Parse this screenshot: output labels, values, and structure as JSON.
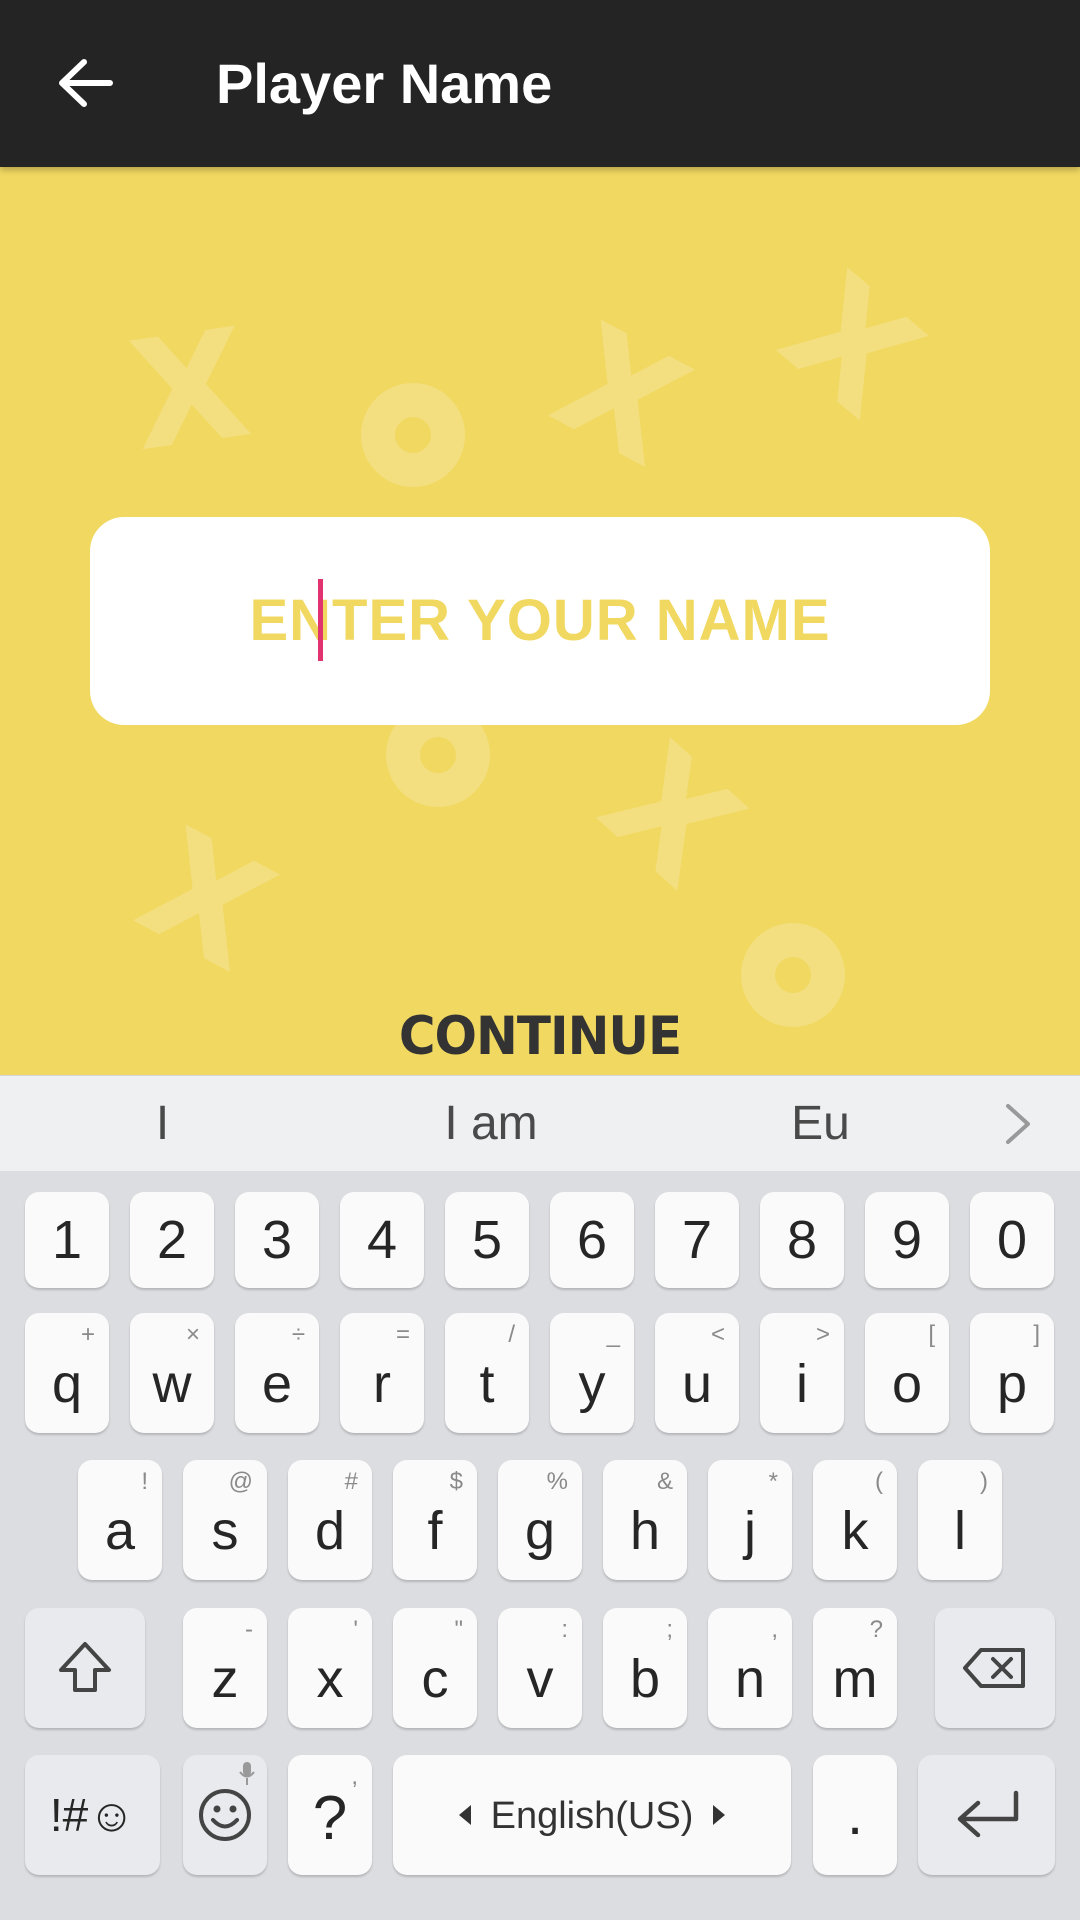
{
  "appbar": {
    "title": "Player Name"
  },
  "name_card": {
    "placeholder": "ENTER YOUR NAME"
  },
  "continue_label": "CONTINUE",
  "colors": {
    "background": "#f1d861",
    "appbar": "#242424",
    "caret": "#e0336f",
    "placeholder": "#f1d861"
  },
  "keyboard": {
    "suggestions": [
      "I",
      "I am",
      "Eu"
    ],
    "row_digits": [
      "1",
      "2",
      "3",
      "4",
      "5",
      "6",
      "7",
      "8",
      "9",
      "0"
    ],
    "row_q": [
      {
        "k": "q",
        "h": "+"
      },
      {
        "k": "w",
        "h": "×"
      },
      {
        "k": "e",
        "h": "÷"
      },
      {
        "k": "r",
        "h": "="
      },
      {
        "k": "t",
        "h": "/"
      },
      {
        "k": "y",
        "h": "_"
      },
      {
        "k": "u",
        "h": "<"
      },
      {
        "k": "i",
        "h": ">"
      },
      {
        "k": "o",
        "h": "["
      },
      {
        "k": "p",
        "h": "]"
      }
    ],
    "row_a": [
      {
        "k": "a",
        "h": "!"
      },
      {
        "k": "s",
        "h": "@"
      },
      {
        "k": "d",
        "h": "#"
      },
      {
        "k": "f",
        "h": "$"
      },
      {
        "k": "g",
        "h": "%"
      },
      {
        "k": "h",
        "h": "&"
      },
      {
        "k": "j",
        "h": "*"
      },
      {
        "k": "k",
        "h": "("
      },
      {
        "k": "l",
        "h": ")"
      }
    ],
    "row_z": [
      {
        "k": "z",
        "h": "-"
      },
      {
        "k": "x",
        "h": "'"
      },
      {
        "k": "c",
        "h": "\""
      },
      {
        "k": "v",
        "h": ":"
      },
      {
        "k": "b",
        "h": ";"
      },
      {
        "k": "n",
        "h": ","
      },
      {
        "k": "m",
        "h": "?"
      }
    ],
    "symbols_label": "!#☺",
    "question_key": "?",
    "question_hint": ",",
    "space_label": "English(US)",
    "period_key": "."
  }
}
